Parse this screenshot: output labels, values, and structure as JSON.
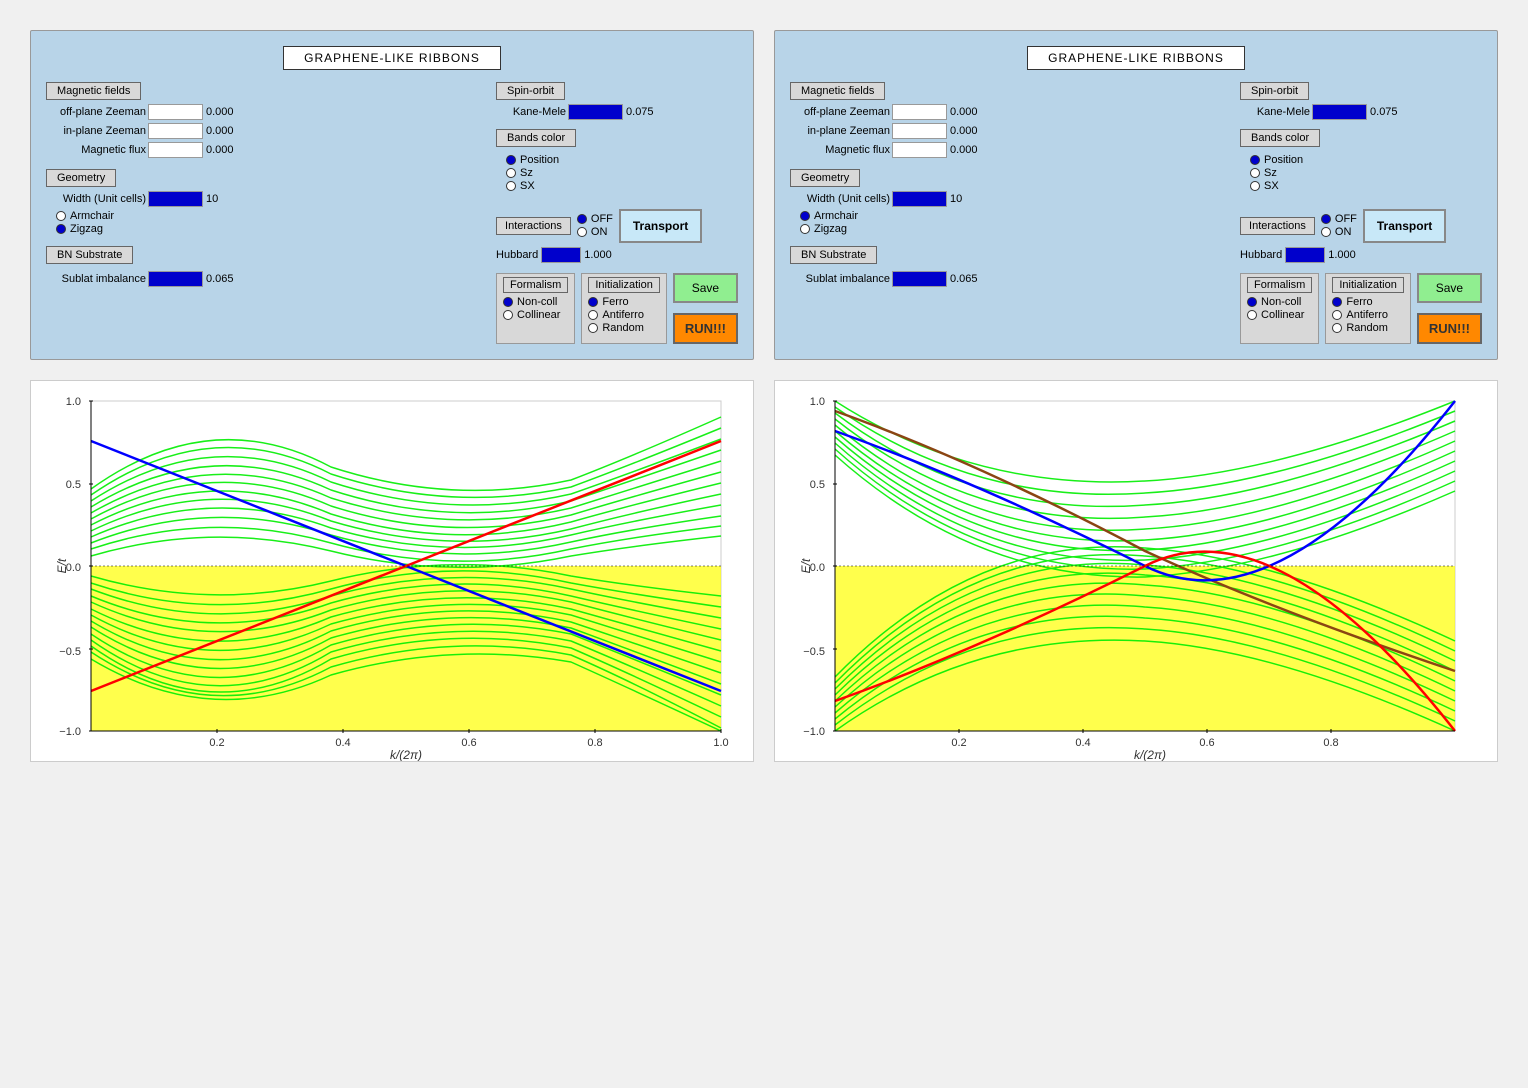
{
  "panels": [
    {
      "id": "panel1",
      "title": "GRAPHENE-LIKE RIBBONS",
      "magnetic_fields": {
        "label": "Magnetic fields",
        "off_plane_zeeman": {
          "label": "off-plane Zeeman",
          "value": "0.000"
        },
        "in_plane_zeeman": {
          "label": "in-plane Zeeman",
          "value": "0.000"
        },
        "magnetic_flux": {
          "label": "Magnetic flux",
          "value": "0.000"
        }
      },
      "spin_orbit": {
        "label": "Spin-orbit",
        "kane_mele": {
          "label": "Kane-Mele",
          "value": "0.075"
        }
      },
      "bands_color": {
        "label": "Bands color",
        "options": [
          "Position",
          "Sz",
          "SX"
        ],
        "selected": 0
      },
      "geometry": {
        "label": "Geometry",
        "width_label": "Width (Unit cells)",
        "width_value": "10",
        "options": [
          "Armchair",
          "Zigzag"
        ],
        "selected": 1
      },
      "interactions": {
        "label": "Interactions",
        "off_label": "OFF",
        "on_label": "ON",
        "selected": "OFF",
        "hubbard_label": "Hubbard",
        "hubbard_value": "1.000"
      },
      "bn_substrate": {
        "label": "BN Substrate",
        "sublat_label": "Sublat imbalance",
        "sublat_value": "0.065"
      },
      "formalism": {
        "label": "Formalism",
        "options": [
          "Non-coll",
          "Collinear"
        ],
        "selected": 0
      },
      "initialization": {
        "label": "Initialization",
        "options": [
          "Ferro",
          "Antiferro",
          "Random"
        ],
        "selected": 0
      },
      "transport_btn": "Transport",
      "save_btn": "Save",
      "run_btn": "RUN!!!"
    },
    {
      "id": "panel2",
      "title": "GRAPHENE-LIKE RIBBONS",
      "magnetic_fields": {
        "label": "Magnetic fields",
        "off_plane_zeeman": {
          "label": "off-plane Zeeman",
          "value": "0.000"
        },
        "in_plane_zeeman": {
          "label": "in-plane Zeeman",
          "value": "0.000"
        },
        "magnetic_flux": {
          "label": "Magnetic flux",
          "value": "0.000"
        }
      },
      "spin_orbit": {
        "label": "Spin-orbit",
        "kane_mele": {
          "label": "Kane-Mele",
          "value": "0.075"
        }
      },
      "bands_color": {
        "label": "Bands color",
        "options": [
          "Position",
          "Sz",
          "SX"
        ],
        "selected": 0
      },
      "geometry": {
        "label": "Geometry",
        "width_label": "Width (Unit cells)",
        "width_value": "10",
        "options": [
          "Armchair",
          "Zigzag"
        ],
        "selected": 1
      },
      "interactions": {
        "label": "Interactions",
        "off_label": "OFF",
        "on_label": "ON",
        "selected": "OFF",
        "hubbard_label": "Hubbard",
        "hubbard_value": "1.000"
      },
      "bn_substrate": {
        "label": "BN Substrate",
        "sublat_label": "Sublat imbalance",
        "sublat_value": "0.065"
      },
      "formalism": {
        "label": "Formalism",
        "options": [
          "Non-coll",
          "Collinear"
        ],
        "selected": 0
      },
      "initialization": {
        "label": "Initialization",
        "options": [
          "Ferro",
          "Antiferro",
          "Random"
        ],
        "selected": 0
      },
      "transport_btn": "Transport",
      "save_btn": "Save",
      "run_btn": "RUN!!!"
    }
  ],
  "charts": [
    {
      "id": "chart1",
      "y_label": "E/t",
      "x_label": "k/(2π)",
      "y_ticks": [
        "1.0",
        "0.5",
        "0.0",
        "-0.5",
        "-1.0"
      ],
      "x_ticks": [
        "0.2",
        "0.4",
        "0.6",
        "0.8",
        "1.0"
      ]
    },
    {
      "id": "chart2",
      "y_label": "E/t",
      "x_label": "k/(2π)",
      "y_ticks": [
        "1.0",
        "0.5",
        "0.0",
        "-0.5",
        "-1.0"
      ],
      "x_ticks": [
        "0.2",
        "0.4",
        "0.6",
        "0.8"
      ]
    }
  ]
}
